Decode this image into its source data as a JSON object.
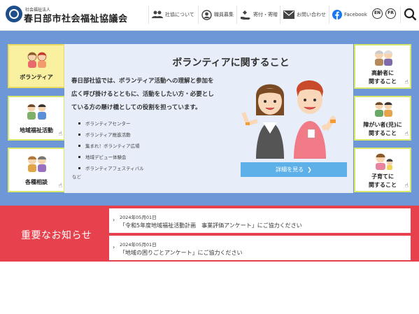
{
  "header": {
    "org_small": "社会福祉法人",
    "org_name": "春日部市社会福祉協議会",
    "nav": [
      {
        "label": "社協について",
        "icon": "people-icon"
      },
      {
        "label": "職員募集",
        "icon": "person-circle-icon"
      },
      {
        "label": "寄付・寄贈",
        "icon": "donation-hand-icon"
      },
      {
        "label": "お問い合わせ",
        "icon": "mail-icon"
      },
      {
        "label": "Facebook",
        "icon": "facebook-icon"
      }
    ],
    "lang_en": "EN",
    "lang_fr": "FR"
  },
  "tiles_left": [
    {
      "label": "ボランティア",
      "active": true
    },
    {
      "label": "地域福祉活動"
    },
    {
      "label": "各種相談"
    }
  ],
  "tiles_right": [
    {
      "lines": [
        "高齢者に",
        "関すること"
      ]
    },
    {
      "lines": [
        "障がい者(児)に",
        "関すること"
      ]
    },
    {
      "lines": [
        "子育てに",
        "関すること"
      ]
    }
  ],
  "panel": {
    "title": "ボランティアに関すること",
    "desc": [
      "春日部社協では、ボランティア活動への理解と参加を",
      "広く呼び掛けるとともに、活動をしたい方・必要とし",
      "ている方の懸け橋としての役割を担っています。"
    ],
    "items": [
      "ボランティアセンター",
      "ボランティア推進活動",
      "集まれ！ボランティア広場",
      "地域デビュー体験会",
      "ボランティアフェスティバル"
    ],
    "etc": "など",
    "detail_button": "詳細を見る"
  },
  "notices": {
    "title": "重要なお知らせ",
    "items": [
      {
        "date": "2024年05月01日",
        "text": "「令和5年度地域福祉活動計画　事業評価アンケート」にご協力ください"
      },
      {
        "date": "2024年05月01日",
        "text": "「地域の困りごとアンケート」にご協力ください"
      }
    ]
  },
  "colors": {
    "brand_blue": "#1e4f8a",
    "banner": "#6d97d6",
    "notice_red": "#e7414d",
    "tile_border": "#d7e86a",
    "button": "#5db0e8"
  }
}
